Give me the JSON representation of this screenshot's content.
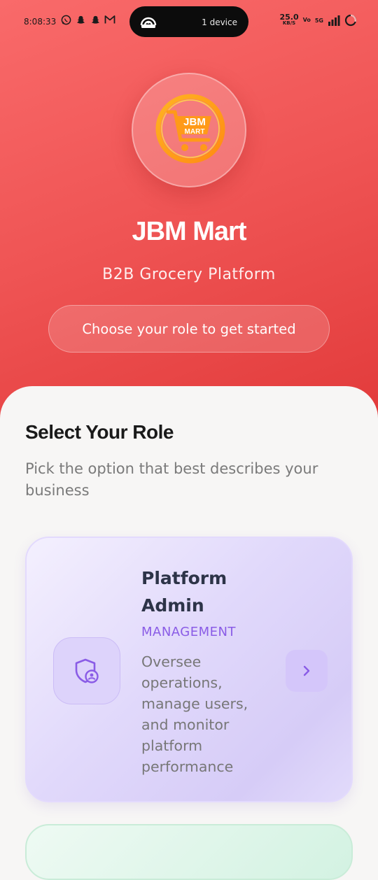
{
  "status_bar": {
    "time": "8:08:33",
    "hotspot_label": "1 device",
    "speed_value": "25.0",
    "speed_unit": "KB/S",
    "network": "5G",
    "carrier_tag": "Vo"
  },
  "brand": {
    "logo_text_top": "JBM",
    "logo_text_bottom": "MART",
    "title": "JBM Mart",
    "subtitle": "B2B Grocery Platform",
    "cta": "Choose your role to get started"
  },
  "roles_section": {
    "title": "Select Your Role",
    "subtitle": "Pick the option that best describes your business",
    "cards": [
      {
        "title": "Platform Admin",
        "tag": "MANAGEMENT",
        "description": "Oversee operations, manage users, and monitor platform performance",
        "icon": "shield-user-icon",
        "accent": "#8a5ce6"
      }
    ]
  },
  "colors": {
    "hero_gradient_start": "#f96a6a",
    "hero_gradient_end": "#e23b3b",
    "admin_accent": "#8a5ce6",
    "card_bg": "#e1d9fb"
  }
}
